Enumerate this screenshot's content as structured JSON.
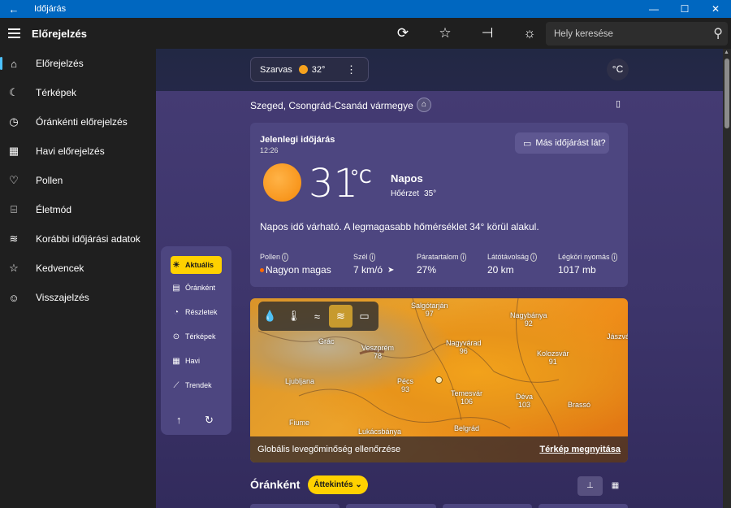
{
  "window": {
    "title": "Időjárás",
    "back_icon": "arrow-left-icon",
    "controls": [
      "minimize-icon",
      "maximize-icon",
      "close-icon"
    ]
  },
  "appbar": {
    "title": "Előrejelzés",
    "actions": [
      "refresh-icon",
      "star-icon",
      "pin-icon",
      "settings-icon"
    ],
    "search_placeholder": "Hely keresése"
  },
  "sidebar": {
    "items": [
      {
        "label": "Előrejelzés",
        "icon": "home-icon",
        "active": true
      },
      {
        "label": "Térképek",
        "icon": "map-icon"
      },
      {
        "label": "Óránkénti előrejelzés",
        "icon": "clock-icon"
      },
      {
        "label": "Havi előrejelzés",
        "icon": "calendar-icon"
      },
      {
        "label": "Pollen",
        "icon": "pollen-icon"
      },
      {
        "label": "Életmód",
        "icon": "lifestyle-icon"
      },
      {
        "label": "Korábbi időjárási adatok",
        "icon": "history-chart-icon"
      },
      {
        "label": "Kedvencek",
        "icon": "favorites-icon"
      },
      {
        "label": "Visszajelzés",
        "icon": "feedback-icon"
      }
    ]
  },
  "pill": {
    "name": "Szarvas",
    "temp": "32°"
  },
  "unit": "°C",
  "location": "Szeged, Csongrád-Csanád vármegye",
  "current": {
    "title": "Jelenlegi időjárás",
    "time": "12:26",
    "feedback": "Más időjárást lát?",
    "temp": "31",
    "unit": "°C",
    "condition": "Napos",
    "feels_label": "Hőérzet",
    "feels_value": "35°",
    "description": "Napos idő várható. A legmagasabb hőmérséklet 34° körül alakul.",
    "metrics": [
      {
        "label": "Pollen",
        "value": "Nagyon magas"
      },
      {
        "label": "Szél",
        "value": "7 km/ó"
      },
      {
        "label": "Páratartalom",
        "value": "27%"
      },
      {
        "label": "Látótávolság",
        "value": "20 km"
      },
      {
        "label": "Légköri nyomás",
        "value": "1017 mb"
      }
    ]
  },
  "panel": {
    "items": [
      {
        "label": "Aktuális",
        "icon": "sun-icon",
        "active": true
      },
      {
        "label": "Óránként",
        "icon": "hourly-icon"
      },
      {
        "label": "Részletek",
        "icon": "details-icon"
      },
      {
        "label": "Térképek",
        "icon": "map-pin-icon"
      },
      {
        "label": "Havi",
        "icon": "calendar-icon"
      },
      {
        "label": "Trendek",
        "icon": "trend-icon"
      }
    ]
  },
  "map": {
    "layers": [
      "precipitation-icon",
      "temperature-icon",
      "wind-icon",
      "air-quality-icon",
      "chat-icon"
    ],
    "cities": [
      {
        "name": "Salgótarján",
        "value": "97"
      },
      {
        "name": "Nagybánya",
        "value": "92"
      },
      {
        "name": "Grác",
        "value": ""
      },
      {
        "name": "Veszprém",
        "value": "78"
      },
      {
        "name": "Nagyvárad",
        "value": "96"
      },
      {
        "name": "Kolozsvár",
        "value": "91"
      },
      {
        "name": "Jászvá",
        "value": ""
      },
      {
        "name": "Ljubljana",
        "value": ""
      },
      {
        "name": "Pécs",
        "value": "93"
      },
      {
        "name": "Temesvár",
        "value": "106"
      },
      {
        "name": "Déva",
        "value": "103"
      },
      {
        "name": "Brassó",
        "value": ""
      },
      {
        "name": "Fiume",
        "value": ""
      },
      {
        "name": "Lukácsbánya",
        "value": ""
      },
      {
        "name": "Belgrád",
        "value": ""
      }
    ],
    "footer_label": "Globális levegőminőség ellenőrzése",
    "footer_link": "Térkép megnyitása"
  },
  "hourly": {
    "title": "Óránként",
    "dropdown": "Áttekintés"
  }
}
